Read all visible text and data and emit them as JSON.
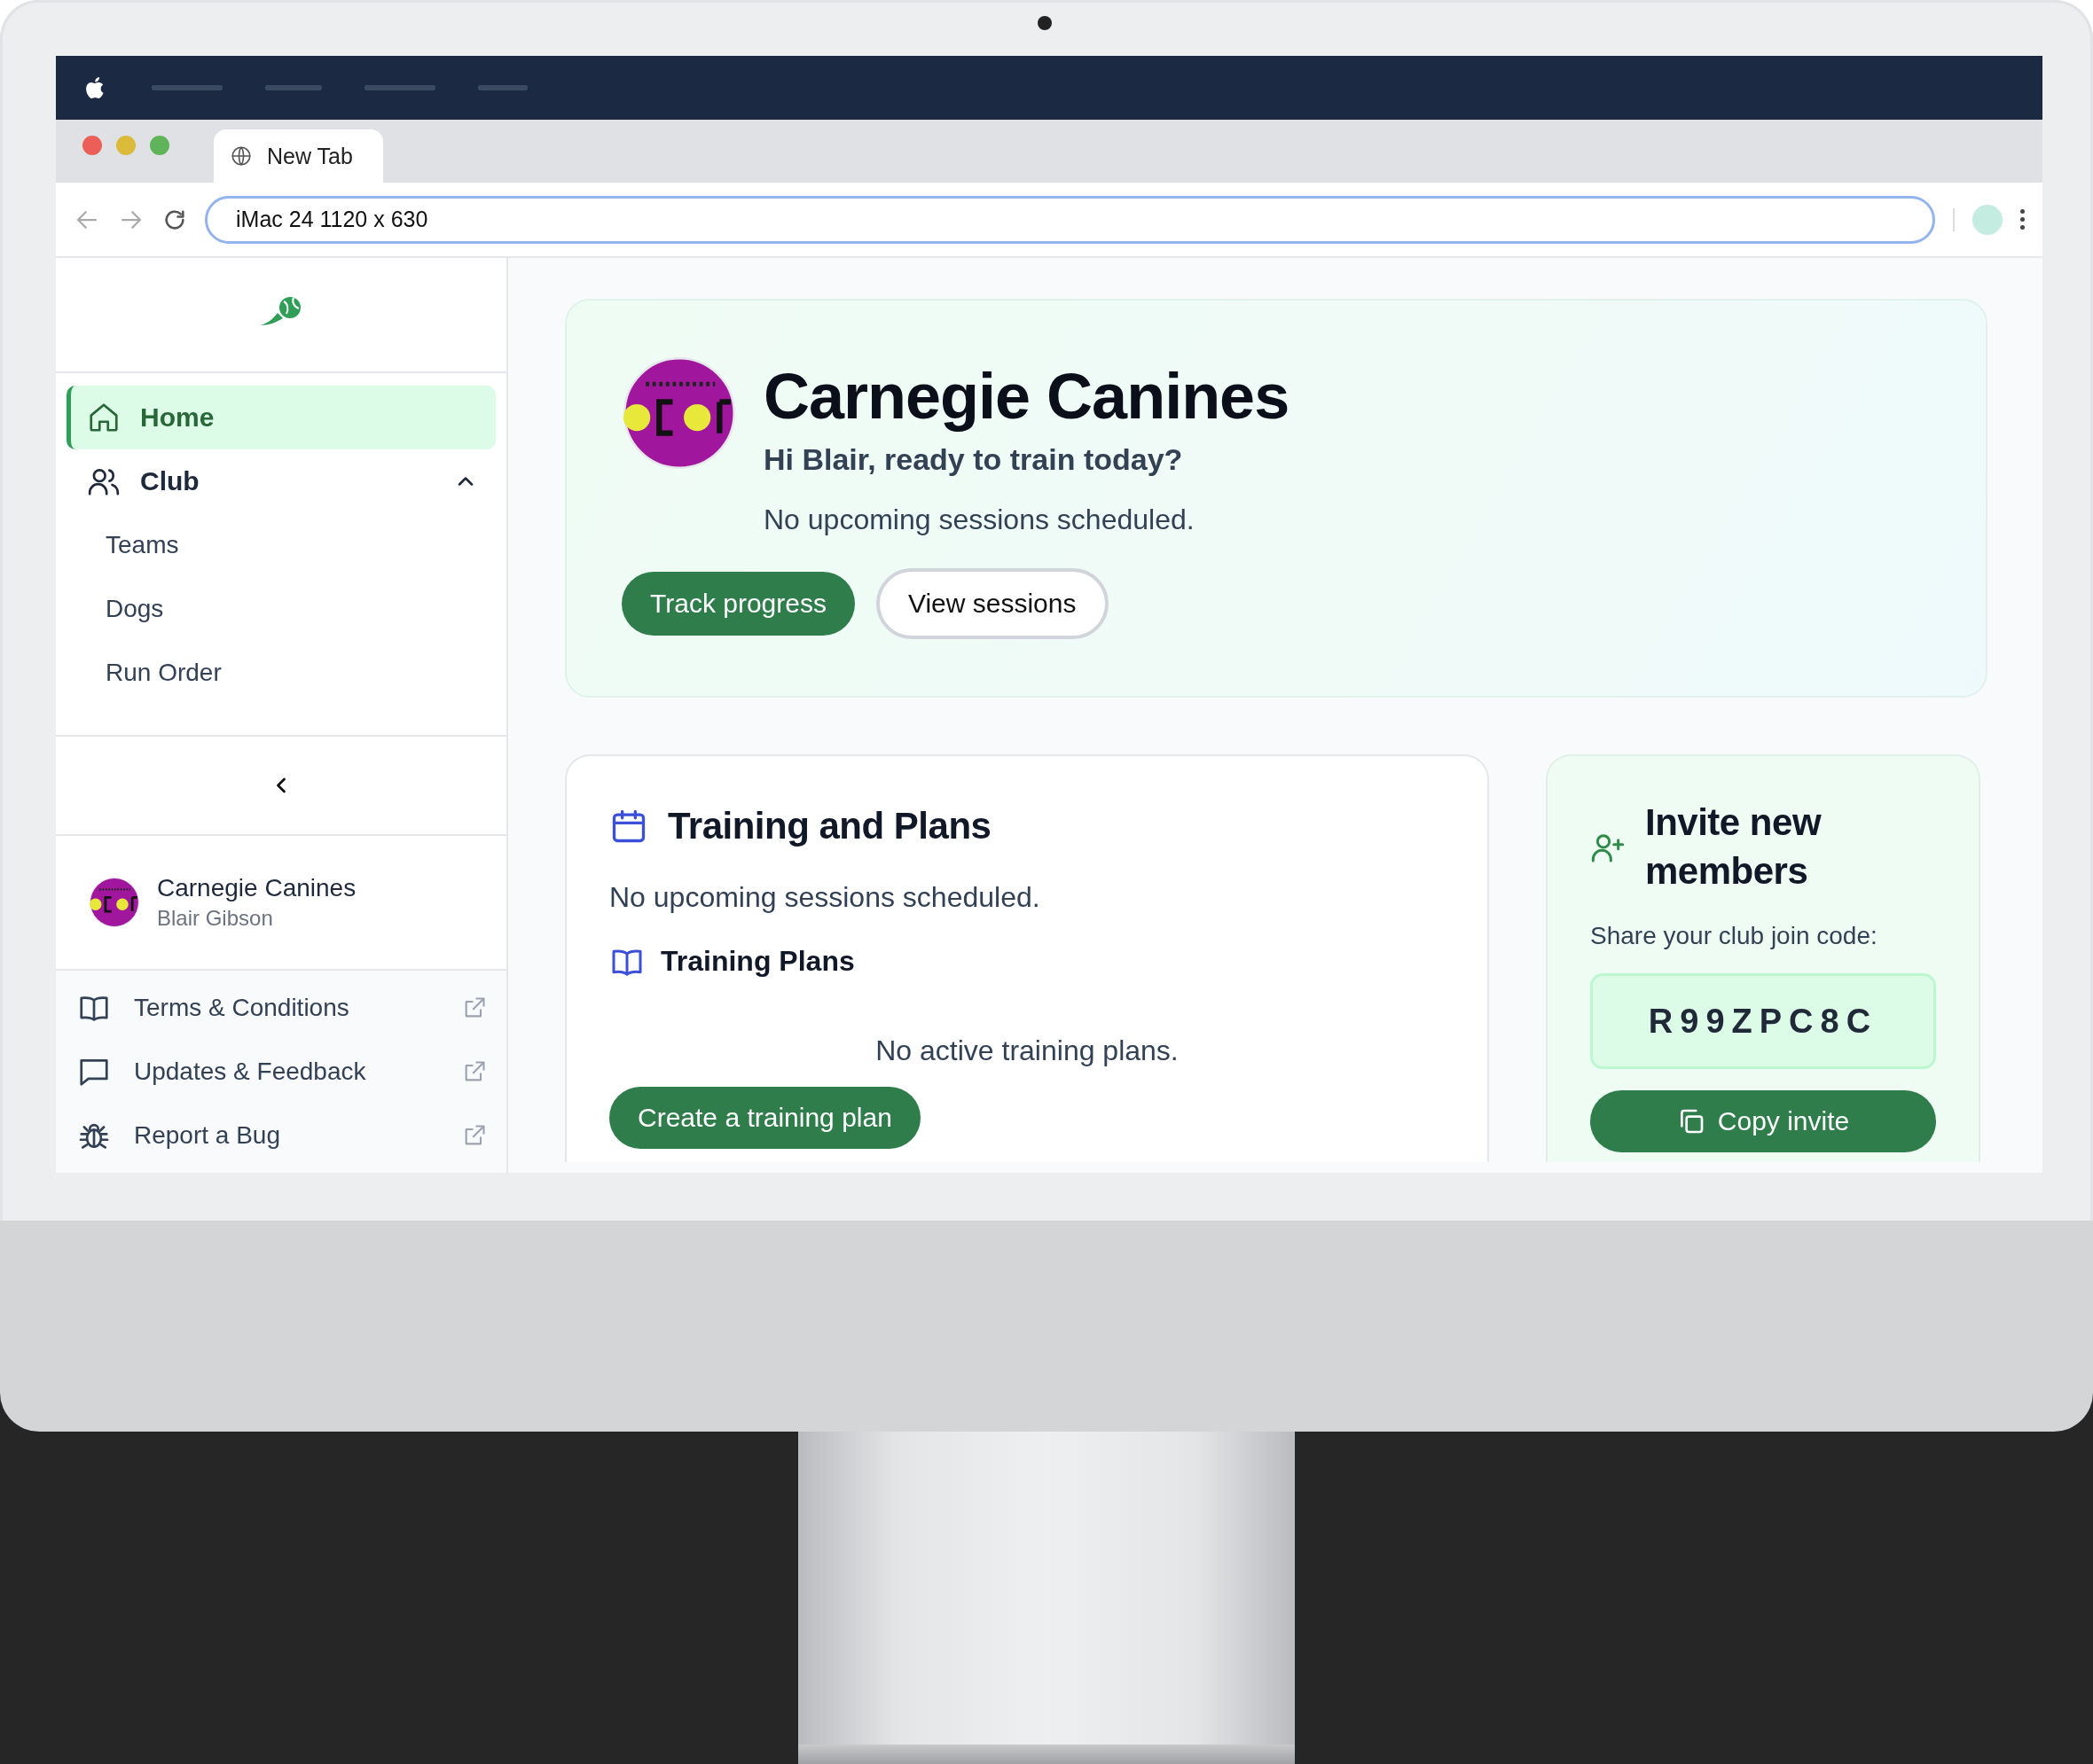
{
  "browser": {
    "tab_title": "New Tab",
    "address": "iMac 24  1120 x 630"
  },
  "sidebar": {
    "nav": [
      {
        "label": "Home",
        "selected": true
      },
      {
        "label": "Club",
        "selected": false,
        "expanded": true,
        "children": [
          {
            "label": "Teams",
            "selected": false
          },
          {
            "label": "Dogs",
            "selected": false
          },
          {
            "label": "Run Order",
            "selected": false
          }
        ]
      }
    ],
    "club": {
      "name": "Carnegie Canines",
      "user": "Blair Gibson"
    },
    "links": [
      {
        "label": "Terms & Conditions"
      },
      {
        "label": "Updates & Feedback"
      },
      {
        "label": "Report a Bug"
      }
    ]
  },
  "hero": {
    "title": "Carnegie Canines",
    "greeting": "Hi Blair, ready to train today?",
    "status": "No upcoming sessions scheduled.",
    "buttons": [
      {
        "label": "Track progress",
        "kind": "primary"
      },
      {
        "label": "View sessions",
        "kind": "secondary"
      }
    ]
  },
  "training": {
    "title": "Training and Plans",
    "status": "No upcoming sessions scheduled.",
    "plans_title": "Training Plans",
    "plans_empty": "No active training plans.",
    "button": "Create a training plan"
  },
  "invite": {
    "title": "Invite new members",
    "prompt": "Share your club join code:",
    "code": "R99ZPC8C",
    "button": "Copy invite"
  }
}
